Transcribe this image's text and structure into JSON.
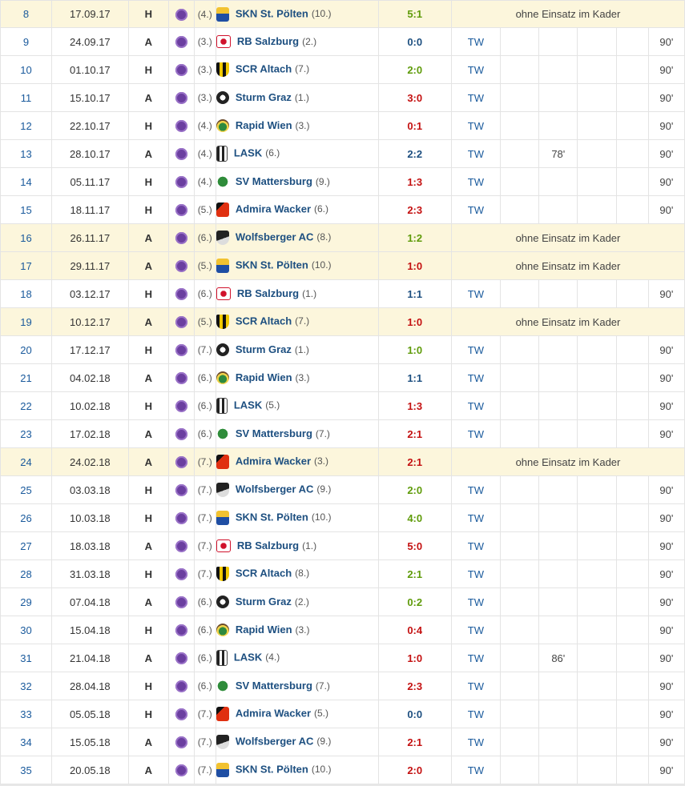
{
  "columns": [
    "matchday",
    "date",
    "venue",
    "club",
    "club_rank",
    "opponent",
    "result",
    "position",
    "c1",
    "c2",
    "c3",
    "c4",
    "minutes"
  ],
  "colors": {
    "win": "#5f9b0a",
    "draw": "#1d4f80",
    "loss": "#c41111",
    "bench_row": "#fcf6dc",
    "link": "#1a5a9c"
  },
  "club_icon": "austria-wien-crest-icon",
  "rows": [
    {
      "md": "8",
      "date": "17.09.17",
      "venue": "H",
      "rank": "(4.)",
      "opp": "SKN St. Pölten",
      "opp_rank": "(10.)",
      "logo": "logo-stp",
      "result": "5:1",
      "res_type": "win",
      "bench": true,
      "note": "ohne Einsatz im Kader"
    },
    {
      "md": "9",
      "date": "24.09.17",
      "venue": "A",
      "rank": "(3.)",
      "opp": "RB Salzburg",
      "opp_rank": "(2.)",
      "logo": "logo-rbs",
      "result": "0:0",
      "res_type": "draw",
      "pos": "TW",
      "min": "90'"
    },
    {
      "md": "10",
      "date": "01.10.17",
      "venue": "H",
      "rank": "(3.)",
      "opp": "SCR Altach",
      "opp_rank": "(7.)",
      "logo": "logo-alt",
      "result": "2:0",
      "res_type": "win",
      "pos": "TW",
      "min": "90'"
    },
    {
      "md": "11",
      "date": "15.10.17",
      "venue": "A",
      "rank": "(3.)",
      "opp": "Sturm Graz",
      "opp_rank": "(1.)",
      "logo": "logo-stu",
      "result": "3:0",
      "res_type": "loss",
      "pos": "TW",
      "min": "90'"
    },
    {
      "md": "12",
      "date": "22.10.17",
      "venue": "H",
      "rank": "(4.)",
      "opp": "Rapid Wien",
      "opp_rank": "(3.)",
      "logo": "logo-rap",
      "result": "0:1",
      "res_type": "loss",
      "pos": "TW",
      "min": "90'"
    },
    {
      "md": "13",
      "date": "28.10.17",
      "venue": "A",
      "rank": "(4.)",
      "opp": "LASK",
      "opp_rank": "(6.)",
      "logo": "logo-las",
      "result": "2:2",
      "res_type": "draw",
      "pos": "TW",
      "c2": "78'",
      "min": "90'"
    },
    {
      "md": "14",
      "date": "05.11.17",
      "venue": "H",
      "rank": "(4.)",
      "opp": "SV Mattersburg",
      "opp_rank": "(9.)",
      "logo": "logo-svm",
      "result": "1:3",
      "res_type": "loss",
      "pos": "TW",
      "min": "90'"
    },
    {
      "md": "15",
      "date": "18.11.17",
      "venue": "H",
      "rank": "(5.)",
      "opp": "Admira Wacker",
      "opp_rank": "(6.)",
      "logo": "logo-adm",
      "result": "2:3",
      "res_type": "loss",
      "pos": "TW",
      "min": "90'"
    },
    {
      "md": "16",
      "date": "26.11.17",
      "venue": "A",
      "rank": "(6.)",
      "opp": "Wolfsberger AC",
      "opp_rank": "(8.)",
      "logo": "logo-wac",
      "result": "1:2",
      "res_type": "win",
      "bench": true,
      "note": "ohne Einsatz im Kader"
    },
    {
      "md": "17",
      "date": "29.11.17",
      "venue": "A",
      "rank": "(5.)",
      "opp": "SKN St. Pölten",
      "opp_rank": "(10.)",
      "logo": "logo-stp",
      "result": "1:0",
      "res_type": "loss",
      "bench": true,
      "note": "ohne Einsatz im Kader"
    },
    {
      "md": "18",
      "date": "03.12.17",
      "venue": "H",
      "rank": "(6.)",
      "opp": "RB Salzburg",
      "opp_rank": "(1.)",
      "logo": "logo-rbs",
      "result": "1:1",
      "res_type": "draw",
      "pos": "TW",
      "min": "90'"
    },
    {
      "md": "19",
      "date": "10.12.17",
      "venue": "A",
      "rank": "(5.)",
      "opp": "SCR Altach",
      "opp_rank": "(7.)",
      "logo": "logo-alt",
      "result": "1:0",
      "res_type": "loss",
      "bench": true,
      "note": "ohne Einsatz im Kader"
    },
    {
      "md": "20",
      "date": "17.12.17",
      "venue": "H",
      "rank": "(7.)",
      "opp": "Sturm Graz",
      "opp_rank": "(1.)",
      "logo": "logo-stu",
      "result": "1:0",
      "res_type": "win",
      "pos": "TW",
      "min": "90'"
    },
    {
      "md": "21",
      "date": "04.02.18",
      "venue": "A",
      "rank": "(6.)",
      "opp": "Rapid Wien",
      "opp_rank": "(3.)",
      "logo": "logo-rap",
      "result": "1:1",
      "res_type": "draw",
      "pos": "TW",
      "min": "90'"
    },
    {
      "md": "22",
      "date": "10.02.18",
      "venue": "H",
      "rank": "(6.)",
      "opp": "LASK",
      "opp_rank": "(5.)",
      "logo": "logo-las",
      "result": "1:3",
      "res_type": "loss",
      "pos": "TW",
      "min": "90'"
    },
    {
      "md": "23",
      "date": "17.02.18",
      "venue": "A",
      "rank": "(6.)",
      "opp": "SV Mattersburg",
      "opp_rank": "(7.)",
      "logo": "logo-svm",
      "result": "2:1",
      "res_type": "loss",
      "pos": "TW",
      "min": "90'"
    },
    {
      "md": "24",
      "date": "24.02.18",
      "venue": "A",
      "rank": "(7.)",
      "opp": "Admira Wacker",
      "opp_rank": "(3.)",
      "logo": "logo-adm",
      "result": "2:1",
      "res_type": "loss",
      "bench": true,
      "note": "ohne Einsatz im Kader"
    },
    {
      "md": "25",
      "date": "03.03.18",
      "venue": "H",
      "rank": "(7.)",
      "opp": "Wolfsberger AC",
      "opp_rank": "(9.)",
      "logo": "logo-wac",
      "result": "2:0",
      "res_type": "win",
      "pos": "TW",
      "min": "90'"
    },
    {
      "md": "26",
      "date": "10.03.18",
      "venue": "H",
      "rank": "(7.)",
      "opp": "SKN St. Pölten",
      "opp_rank": "(10.)",
      "logo": "logo-stp",
      "result": "4:0",
      "res_type": "win",
      "pos": "TW",
      "min": "90'"
    },
    {
      "md": "27",
      "date": "18.03.18",
      "venue": "A",
      "rank": "(7.)",
      "opp": "RB Salzburg",
      "opp_rank": "(1.)",
      "logo": "logo-rbs",
      "result": "5:0",
      "res_type": "loss",
      "pos": "TW",
      "min": "90'"
    },
    {
      "md": "28",
      "date": "31.03.18",
      "venue": "H",
      "rank": "(7.)",
      "opp": "SCR Altach",
      "opp_rank": "(8.)",
      "logo": "logo-alt",
      "result": "2:1",
      "res_type": "win",
      "pos": "TW",
      "min": "90'"
    },
    {
      "md": "29",
      "date": "07.04.18",
      "venue": "A",
      "rank": "(6.)",
      "opp": "Sturm Graz",
      "opp_rank": "(2.)",
      "logo": "logo-stu",
      "result": "0:2",
      "res_type": "win",
      "pos": "TW",
      "min": "90'"
    },
    {
      "md": "30",
      "date": "15.04.18",
      "venue": "H",
      "rank": "(6.)",
      "opp": "Rapid Wien",
      "opp_rank": "(3.)",
      "logo": "logo-rap",
      "result": "0:4",
      "res_type": "loss",
      "pos": "TW",
      "min": "90'"
    },
    {
      "md": "31",
      "date": "21.04.18",
      "venue": "A",
      "rank": "(6.)",
      "opp": "LASK",
      "opp_rank": "(4.)",
      "logo": "logo-las",
      "result": "1:0",
      "res_type": "loss",
      "pos": "TW",
      "c2": "86'",
      "min": "90'"
    },
    {
      "md": "32",
      "date": "28.04.18",
      "venue": "H",
      "rank": "(6.)",
      "opp": "SV Mattersburg",
      "opp_rank": "(7.)",
      "logo": "logo-svm",
      "result": "2:3",
      "res_type": "loss",
      "pos": "TW",
      "min": "90'"
    },
    {
      "md": "33",
      "date": "05.05.18",
      "venue": "H",
      "rank": "(7.)",
      "opp": "Admira Wacker",
      "opp_rank": "(5.)",
      "logo": "logo-adm",
      "result": "0:0",
      "res_type": "draw",
      "pos": "TW",
      "min": "90'"
    },
    {
      "md": "34",
      "date": "15.05.18",
      "venue": "A",
      "rank": "(7.)",
      "opp": "Wolfsberger AC",
      "opp_rank": "(9.)",
      "logo": "logo-wac",
      "result": "2:1",
      "res_type": "loss",
      "pos": "TW",
      "min": "90'"
    },
    {
      "md": "35",
      "date": "20.05.18",
      "venue": "A",
      "rank": "(7.)",
      "opp": "SKN St. Pölten",
      "opp_rank": "(10.)",
      "logo": "logo-stp",
      "result": "2:0",
      "res_type": "loss",
      "pos": "TW",
      "min": "90'"
    }
  ]
}
